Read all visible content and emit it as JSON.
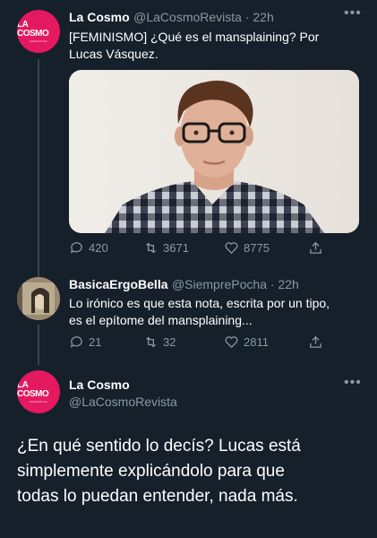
{
  "tweet1": {
    "avatar_brand": "LA COSMO",
    "avatar_sub": "ARGENTINA",
    "name": "La Cosmo",
    "handle": "@LaCosmoRevista · 22h",
    "text_line1": "[FEMINISMO] ¿Qué es el mansplaining? Por",
    "text_line2": "Lucas Vásquez.",
    "replies": "420",
    "retweets": "3671",
    "likes": "8775"
  },
  "tweet2": {
    "name": "BasicaErgoBella",
    "handle": "@SiemprePocha · 22h",
    "text_line1": "Lo irónico es que esta nota, escrita por un tipo,",
    "text_line2": "es el epítome del mansplaining...",
    "replies": "21",
    "retweets": "32",
    "likes": "2811"
  },
  "tweet3": {
    "avatar_brand": "LA COSMO",
    "avatar_sub": "ARGENTINA",
    "name": "La Cosmo",
    "handle": "@LaCosmoRevista",
    "text_line1": "¿En qué sentido lo decís? Lucas está",
    "text_line2": "simplemente explicándolo para que",
    "text_line3": "todas lo puedan entender, nada más."
  },
  "colors": {
    "background": "#15202b",
    "secondary_text": "#8899a6",
    "brand_pink": "#e4195f",
    "thread_line": "#38444d"
  }
}
